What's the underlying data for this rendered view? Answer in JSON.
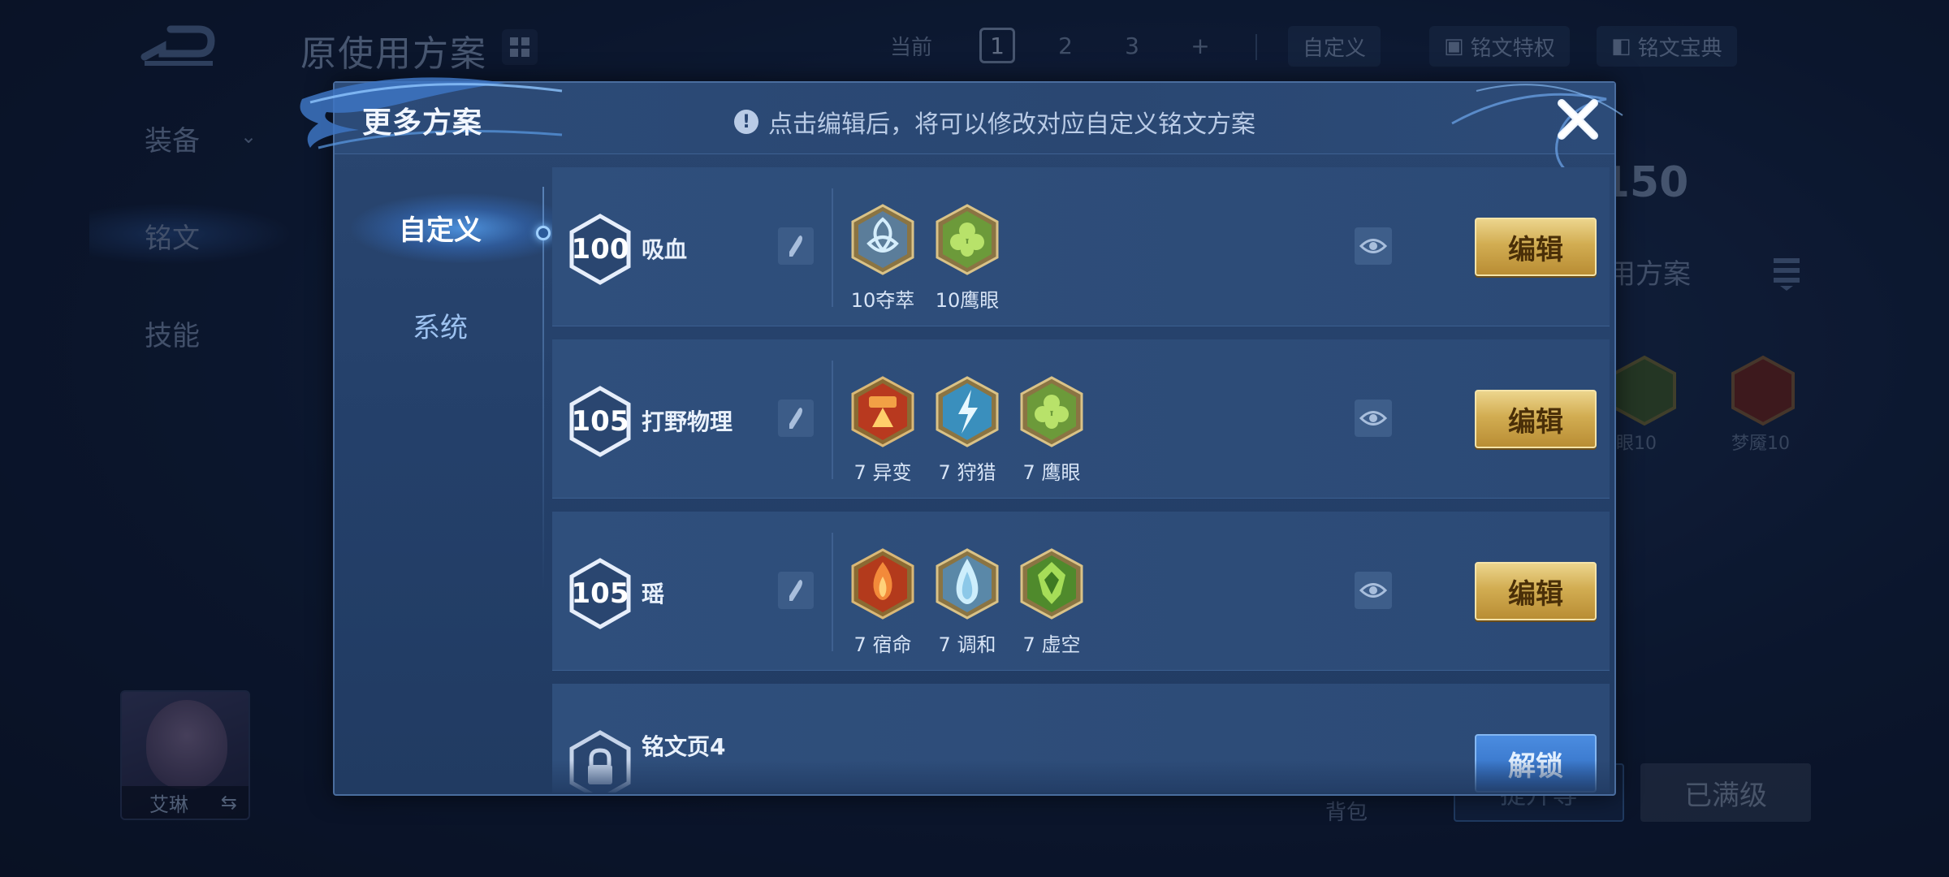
{
  "background": {
    "scheme_title": "原使用方案",
    "current_label": "当前",
    "pages": [
      "1",
      "2",
      "3",
      "+"
    ],
    "custom_label": "自定义",
    "privilege_label": "铭文特权",
    "codex_label": "铭文宝典",
    "side_items": [
      "装备",
      "铭文",
      "技能"
    ],
    "right_number": "150",
    "right_use_text": "用方案",
    "gem_labels": [
      "眼10",
      "梦魇10"
    ],
    "hero_name": "艾琳",
    "backpack_label": "背包",
    "upgrade_label": "提升等",
    "maxed_label": "已满级"
  },
  "modal": {
    "title": "更多方案",
    "hint": "点击编辑后，将可以修改对应自定义铭文方案",
    "tabs": [
      {
        "label": "自定义",
        "active": true
      },
      {
        "label": "系统",
        "active": false
      }
    ],
    "rows": [
      {
        "level": "100",
        "name": "吸血",
        "gems": [
          {
            "label": "10夺萃",
            "icon": "knot-gem-blue"
          },
          {
            "label": "10鹰眼",
            "icon": "clover-gem-green"
          }
        ],
        "action": "编辑"
      },
      {
        "level": "105",
        "name": "打野物理",
        "gems": [
          {
            "label": "7 异变",
            "icon": "spike-gem-red"
          },
          {
            "label": "7 狩猎",
            "icon": "lightning-gem-blue"
          },
          {
            "label": "7 鹰眼",
            "icon": "clover-gem-green"
          }
        ],
        "action": "编辑"
      },
      {
        "level": "105",
        "name": "瑶",
        "gems": [
          {
            "label": "7 宿命",
            "icon": "flame-gem-red"
          },
          {
            "label": "7 调和",
            "icon": "drop-gem-blue"
          },
          {
            "label": "7 虚空",
            "icon": "crest-gem-green"
          }
        ],
        "action": "编辑"
      },
      {
        "name": "铭文页4",
        "locked": true,
        "action": "解锁"
      }
    ]
  },
  "colors": {
    "gold_button": "#d2ad52",
    "blue_button": "#2d69bd",
    "panel": "#2a4670"
  }
}
